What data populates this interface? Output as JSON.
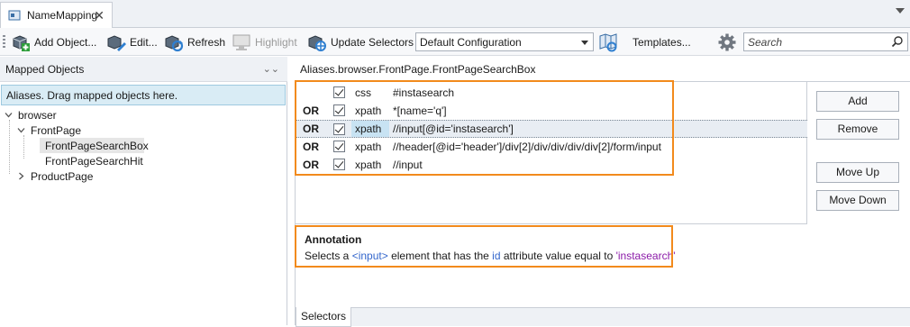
{
  "tab": {
    "title": "NameMapping",
    "close_glyph": "✕"
  },
  "toolbar": {
    "add_object": "Add Object...",
    "edit": "Edit...",
    "refresh": "Refresh",
    "highlight": "Highlight",
    "update_selectors": "Update Selectors",
    "configuration": "Default Configuration",
    "templates": "Templates...",
    "search_placeholder": "Search"
  },
  "left_panel": {
    "title": "Mapped Objects",
    "drop_hint": "Aliases. Drag mapped objects here.",
    "tree": [
      {
        "label": "browser",
        "expanded": true
      },
      {
        "label": "FrontPage",
        "expanded": true
      },
      {
        "label": "FrontPageSearchBox",
        "selected": true
      },
      {
        "label": "FrontPageSearchHit"
      },
      {
        "label": "ProductPage",
        "expanded": false
      }
    ]
  },
  "path": "Aliases.browser.FrontPage.FrontPageSearchBox",
  "selectors": [
    {
      "op": "",
      "checked": true,
      "type": "css",
      "value": "#instasearch"
    },
    {
      "op": "OR",
      "checked": true,
      "type": "xpath",
      "value": "*[name='q']"
    },
    {
      "op": "OR",
      "checked": true,
      "type": "xpath",
      "value": "//input[@id='instasearch']"
    },
    {
      "op": "OR",
      "checked": true,
      "type": "xpath",
      "value": "//header[@id='header']/div[2]/div/div/div/div[2]/form/input"
    },
    {
      "op": "OR",
      "checked": true,
      "type": "xpath",
      "value": "//input"
    }
  ],
  "buttons": {
    "add": "Add",
    "remove": "Remove",
    "move_up": "Move Up",
    "move_down": "Move Down"
  },
  "annotation": {
    "title": "Annotation",
    "p1": "Selects a ",
    "tag": "<input>",
    "p2": " element that has the ",
    "attr": "id",
    "p3": " attribute value equal to ",
    "val": "'instasearch'"
  },
  "bottom_tab": "Selectors",
  "colors": {
    "highlight_border": "#f28a1c",
    "accent_blue": "#3366cc"
  }
}
